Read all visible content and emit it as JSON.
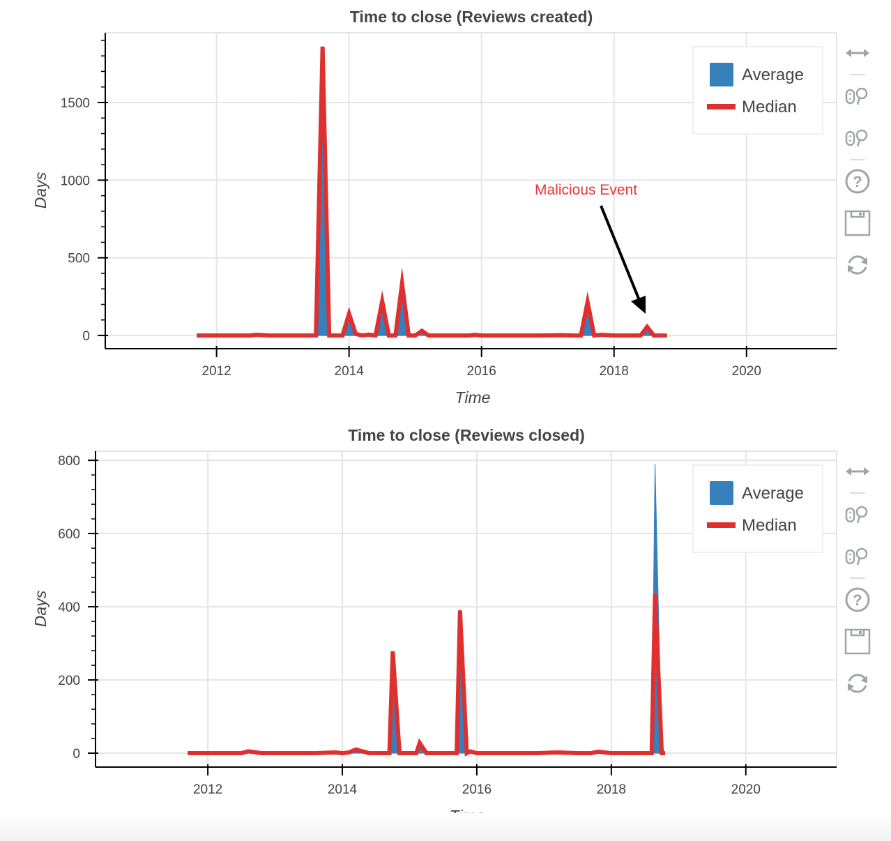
{
  "colors": {
    "average": "#3680bb",
    "median": "#df3030",
    "annotation_text": "#ee3333",
    "annotation_arrow": "#000000",
    "grid": "#e5e5e5",
    "axis": "#000000",
    "text": "#444444",
    "toolbar_icon": "#a0a4a6"
  },
  "toolbar": {
    "tools": [
      {
        "name": "pan-tool",
        "icon": "horizontal-arrows-icon"
      },
      {
        "name": "wheel-zoom-tool",
        "icon": "wheel-zoom-icon"
      },
      {
        "name": "box-zoom-tool",
        "icon": "wheel-zoom-icon"
      },
      {
        "name": "help-tool",
        "icon": "question-circle-icon"
      },
      {
        "name": "save-tool",
        "icon": "floppy-disk-icon"
      },
      {
        "name": "reset-tool",
        "icon": "refresh-icon"
      }
    ]
  },
  "chart_data": [
    {
      "type": "area",
      "title": "Time to close (Reviews created)",
      "xlabel": "Time",
      "ylabel": "Days",
      "xlim": [
        2010.32,
        2021.36
      ],
      "ylim": [
        -85,
        1949
      ],
      "x_ticks": [
        2012,
        2014,
        2016,
        2018,
        2020
      ],
      "x_tick_labels": [
        "2012",
        "2014",
        "2016",
        "2018",
        "2020"
      ],
      "y_ticks": [
        0,
        500,
        1000,
        1500
      ],
      "y_tick_labels": [
        "0",
        "500",
        "1000",
        "1500"
      ],
      "y_minor_step": 100,
      "grid": true,
      "legend": {
        "position": "top-right",
        "entries": [
          {
            "label": "Average",
            "kind": "area"
          },
          {
            "label": "Median",
            "kind": "line"
          }
        ]
      },
      "annotation": {
        "text": "Malicious Event",
        "points_to": [
          2018.5,
          60
        ]
      },
      "x": [
        2011.7,
        2011.9,
        2012.1,
        2012.3,
        2012.5,
        2012.6,
        2012.8,
        2013.0,
        2013.2,
        2013.4,
        2013.5,
        2013.6,
        2013.7,
        2013.8,
        2013.9,
        2014.0,
        2014.1,
        2014.2,
        2014.3,
        2014.4,
        2014.5,
        2014.6,
        2014.7,
        2014.8,
        2014.9,
        2015.0,
        2015.1,
        2015.2,
        2015.4,
        2015.6,
        2015.8,
        2015.9,
        2016.0,
        2016.3,
        2016.6,
        2016.9,
        2017.2,
        2017.4,
        2017.5,
        2017.6,
        2017.7,
        2017.8,
        2018.0,
        2018.2,
        2018.4,
        2018.5,
        2018.6,
        2018.8
      ],
      "series": [
        {
          "name": "Average",
          "values": [
            0,
            0,
            0,
            0,
            0,
            4,
            0,
            0,
            0,
            0,
            0,
            1860,
            0,
            0,
            0,
            140,
            10,
            0,
            5,
            0,
            230,
            0,
            0,
            340,
            0,
            0,
            35,
            0,
            0,
            0,
            0,
            4,
            0,
            0,
            0,
            0,
            2,
            0,
            0,
            220,
            0,
            4,
            0,
            0,
            0,
            60,
            0,
            0
          ]
        },
        {
          "name": "Median",
          "values": [
            0,
            0,
            0,
            0,
            0,
            4,
            0,
            0,
            0,
            0,
            0,
            1860,
            0,
            0,
            0,
            140,
            10,
            0,
            5,
            0,
            220,
            0,
            0,
            335,
            0,
            0,
            30,
            0,
            0,
            0,
            0,
            4,
            0,
            0,
            0,
            0,
            2,
            0,
            0,
            215,
            0,
            4,
            0,
            0,
            0,
            55,
            0,
            0
          ]
        }
      ]
    },
    {
      "type": "area",
      "title": "Time to close (Reviews closed)",
      "xlabel": "Time",
      "ylabel": "Days",
      "xlim": [
        2010.33,
        2021.35
      ],
      "ylim": [
        -38,
        825
      ],
      "x_ticks": [
        2012,
        2014,
        2016,
        2018,
        2020
      ],
      "x_tick_labels": [
        "2012",
        "2014",
        "2016",
        "2018",
        "2020"
      ],
      "y_ticks": [
        0,
        200,
        400,
        600,
        800
      ],
      "y_tick_labels": [
        "0",
        "200",
        "400",
        "600",
        "800"
      ],
      "y_minor_step": 40,
      "grid": true,
      "legend": {
        "position": "top-right",
        "entries": [
          {
            "label": "Average",
            "kind": "area"
          },
          {
            "label": "Median",
            "kind": "line"
          }
        ]
      },
      "x": [
        2011.7,
        2011.9,
        2012.1,
        2012.3,
        2012.5,
        2012.6,
        2012.8,
        2013.0,
        2013.3,
        2013.6,
        2013.9,
        2014.0,
        2014.1,
        2014.2,
        2014.4,
        2014.6,
        2014.7,
        2014.75,
        2014.85,
        2015.0,
        2015.1,
        2015.15,
        2015.25,
        2015.4,
        2015.6,
        2015.7,
        2015.75,
        2015.85,
        2015.9,
        2016.0,
        2016.3,
        2016.6,
        2016.9,
        2017.2,
        2017.5,
        2017.7,
        2017.8,
        2018.0,
        2018.3,
        2018.55,
        2018.6,
        2018.65,
        2018.75,
        2018.8
      ],
      "series": [
        {
          "name": "Average",
          "values": [
            0,
            0,
            0,
            0,
            0,
            5,
            0,
            0,
            0,
            0,
            2,
            0,
            2,
            10,
            0,
            0,
            0,
            280,
            0,
            0,
            0,
            28,
            0,
            0,
            0,
            0,
            392,
            0,
            5,
            0,
            0,
            0,
            0,
            2,
            0,
            0,
            4,
            0,
            0,
            0,
            0,
            790,
            0,
            0
          ]
        },
        {
          "name": "Median",
          "values": [
            0,
            0,
            0,
            0,
            0,
            5,
            0,
            0,
            0,
            0,
            2,
            0,
            2,
            10,
            0,
            0,
            0,
            278,
            0,
            0,
            0,
            28,
            0,
            0,
            0,
            0,
            390,
            0,
            5,
            0,
            0,
            0,
            0,
            2,
            0,
            0,
            4,
            0,
            0,
            0,
            0,
            435,
            0,
            0
          ]
        }
      ]
    }
  ]
}
